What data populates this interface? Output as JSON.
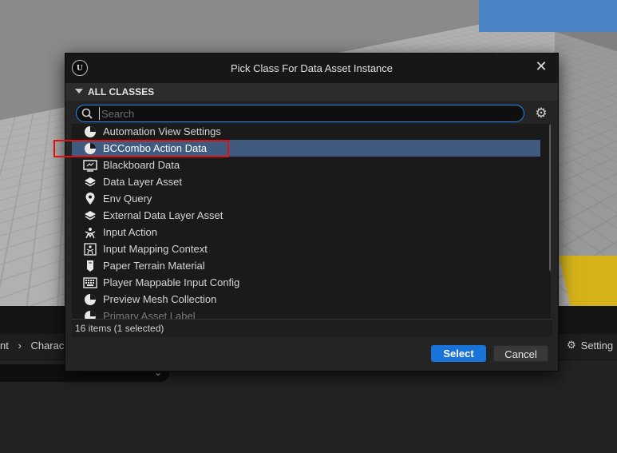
{
  "dialog": {
    "title": "Pick Class For Data Asset Instance",
    "close_label": "✕",
    "logo_glyph": "U",
    "section_title": "ALL CLASSES",
    "search": {
      "placeholder": "Search",
      "value": ""
    },
    "items": [
      {
        "label": "Automation View Settings",
        "icon": "pie-chart-icon",
        "selected": false
      },
      {
        "label": "BCCombo Action Data",
        "icon": "pie-chart-icon",
        "selected": true
      },
      {
        "label": "Blackboard Data",
        "icon": "blackboard-icon",
        "selected": false
      },
      {
        "label": "Data Layer Asset",
        "icon": "layers-icon",
        "selected": false
      },
      {
        "label": "Env Query",
        "icon": "location-pin-icon",
        "selected": false
      },
      {
        "label": "External Data Layer Asset",
        "icon": "layers-icon",
        "selected": false
      },
      {
        "label": "Input Action",
        "icon": "input-action-icon",
        "selected": false
      },
      {
        "label": "Input Mapping Context",
        "icon": "input-mapping-icon",
        "selected": false
      },
      {
        "label": "Paper Terrain Material",
        "icon": "paper-icon",
        "selected": false
      },
      {
        "label": "Player Mappable Input Config",
        "icon": "keyboard-icon",
        "selected": false
      },
      {
        "label": "Preview Mesh Collection",
        "icon": "pie-chart-icon",
        "selected": false
      },
      {
        "label": "Primary Asset Label",
        "icon": "pie-chart-icon",
        "selected": false
      }
    ],
    "status_text": "16 items (1 selected)",
    "select_label": "Select",
    "cancel_label": "Cancel"
  },
  "editor": {
    "breadcrumb_left": "nt",
    "breadcrumb_right": "Charac",
    "settings_label": "Setting"
  },
  "colors": {
    "accent": "#1a73d9",
    "selection": "#405a80",
    "highlight": "#e01010"
  }
}
